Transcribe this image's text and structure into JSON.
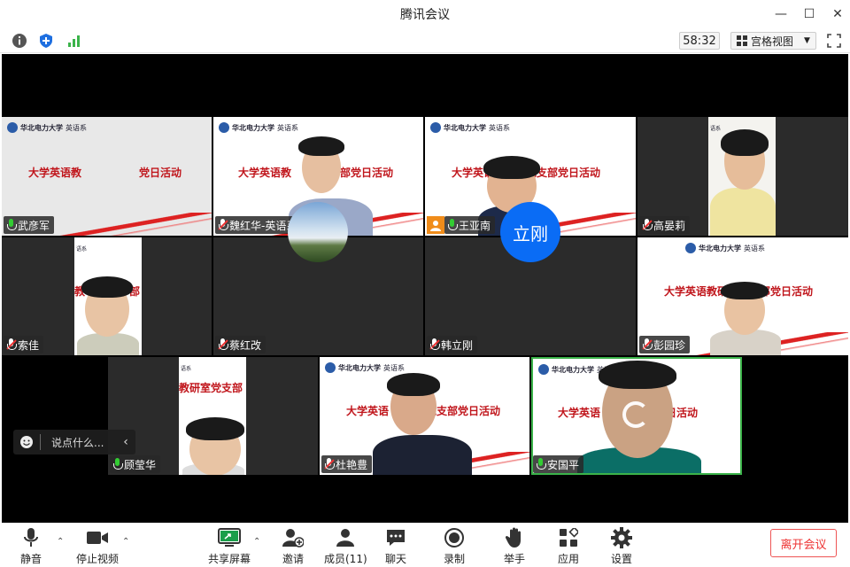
{
  "window": {
    "title": "腾讯会议"
  },
  "topbar": {
    "timer": "58:32",
    "view_label": "宫格视图"
  },
  "participants": [
    {
      "name": "武彦军",
      "banner": "大学英语教",
      "banner2": "党日活动",
      "mic": "active"
    },
    {
      "name": "魏红华-英语系",
      "banner": "大学英语教",
      "banner2": "部党日活动",
      "mic": "muted"
    },
    {
      "name": "王亚南",
      "banner": "大学英语",
      "banner2": "党支部党日活动",
      "mic": "active"
    },
    {
      "name": "高晏莉",
      "mic": "muted"
    },
    {
      "name": "索佳",
      "banner": "教",
      "banner2": "部",
      "mic": "muted"
    },
    {
      "name": "蔡红改",
      "mic": "muted"
    },
    {
      "name": "韩立刚",
      "initial": "立刚",
      "mic": "muted"
    },
    {
      "name": "彭园珍",
      "banner": "大学英语教研",
      "banner2": "支部党日活动",
      "mic": "muted"
    },
    {
      "name": "顾莹华",
      "banner": "教研室党支部",
      "mic": "active"
    },
    {
      "name": "杜艳豊",
      "banner": "大学英语",
      "banner2": "党支部党日活动",
      "mic": "muted"
    },
    {
      "name": "安国平",
      "banner": "大学英语",
      "banner2": "日活动",
      "mic": "active"
    }
  ],
  "logo": {
    "school": "华北电力大学",
    "dept": "英语系",
    "dept_short": "语系"
  },
  "chat": {
    "placeholder": "说点什么..."
  },
  "bottombar": {
    "mute": "静音",
    "stop_video": "停止视频",
    "share": "共享屏幕",
    "invite": "邀请",
    "members": "成员(11)",
    "chat": "聊天",
    "record": "录制",
    "raise_hand": "举手",
    "apps": "应用",
    "settings": "设置",
    "leave": "离开会议"
  },
  "colors": {
    "accent": "#0a6cf5",
    "danger": "#e33",
    "banner_red": "#c0151b"
  }
}
